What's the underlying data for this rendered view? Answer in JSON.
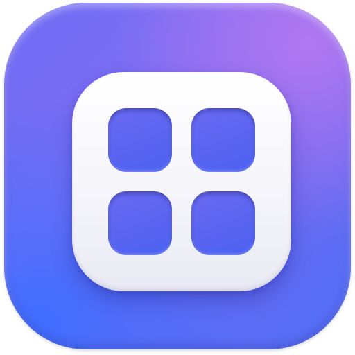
{
  "app_icon": {
    "name": "grid-app-icon",
    "colors": {
      "tile_gradient_start": "#4f6ff7",
      "tile_gradient_end": "#a07af0",
      "inner_square": "#ffffff",
      "cell_fill": "#5a64f0"
    },
    "grid": {
      "rows": 2,
      "columns": 2
    }
  }
}
